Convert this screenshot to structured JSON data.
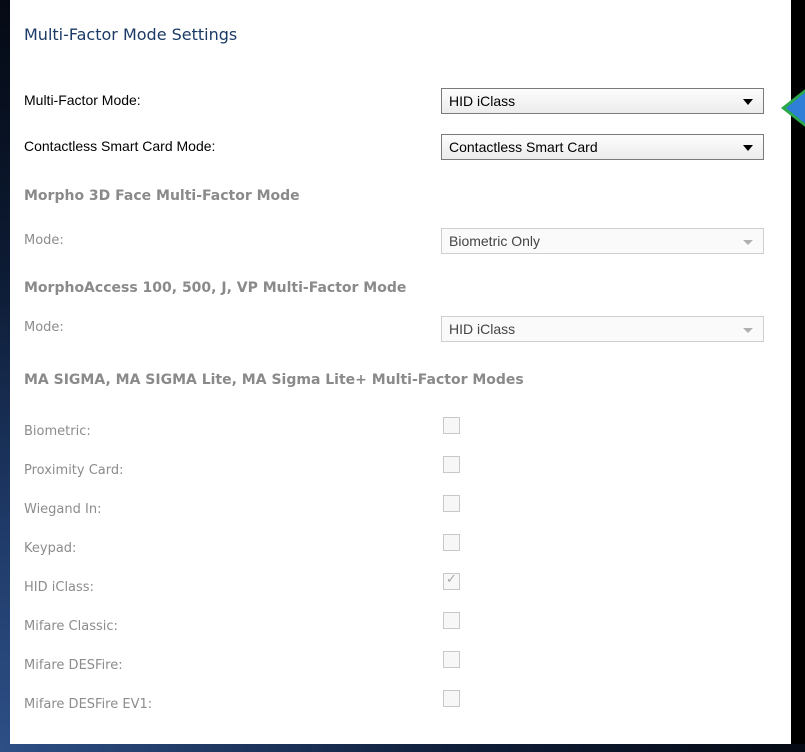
{
  "panel": {
    "title": "Multi-Factor Mode Settings"
  },
  "multi_factor_mode": {
    "label": "Multi-Factor Mode:",
    "value": "HID iClass"
  },
  "contactless_mode": {
    "label": "Contactless Smart Card Mode:",
    "value": "Contactless Smart Card"
  },
  "morpho_3d": {
    "heading": "Morpho 3D Face Multi-Factor Mode",
    "mode_label": "Mode:",
    "mode_value": "Biometric Only"
  },
  "morphoaccess": {
    "heading": "MorphoAccess 100, 500, J, VP Multi-Factor Mode",
    "mode_label": "Mode:",
    "mode_value": "HID iClass"
  },
  "ma_sigma": {
    "heading": "MA SIGMA,  MA SIGMA Lite, MA Sigma Lite+ Multi-Factor Modes",
    "options": [
      {
        "label": "Biometric:",
        "checked": false
      },
      {
        "label": "Proximity Card:",
        "checked": false
      },
      {
        "label": "Wiegand In:",
        "checked": false
      },
      {
        "label": "Keypad:",
        "checked": false
      },
      {
        "label": "HID iClass:",
        "checked": true
      },
      {
        "label": "Mifare Classic:",
        "checked": false
      },
      {
        "label": "Mifare DESFire:",
        "checked": false
      },
      {
        "label": "Mifare DESFire EV1:",
        "checked": false
      }
    ]
  },
  "colors": {
    "title": "#1b3a66",
    "callout_fill": "#2f7fd8",
    "callout_border": "#2aa84a",
    "frame": "#2d4f86"
  }
}
